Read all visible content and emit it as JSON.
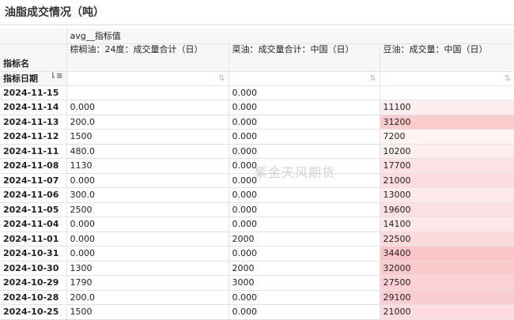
{
  "title": "油脂成交情况（吨）",
  "table": {
    "measure_label": "avg__指标值",
    "dim_label": "指标名",
    "row_dim_label": "指标日期",
    "columns": [
      "棕榈油：24度：成交量合计（日）",
      "菜油：成交量合计：中国（日）",
      "豆油：成交量：中国（日）"
    ],
    "rows": [
      {
        "date": "2024-11-15",
        "c1": "",
        "c2": "0.000",
        "c3": ""
      },
      {
        "date": "2024-11-14",
        "c1": "0.000",
        "c2": "0.000",
        "c3": "11100"
      },
      {
        "date": "2024-11-13",
        "c1": "200.0",
        "c2": "0.000",
        "c3": "31200"
      },
      {
        "date": "2024-11-12",
        "c1": "1500",
        "c2": "0.000",
        "c3": "7200"
      },
      {
        "date": "2024-11-11",
        "c1": "480.0",
        "c2": "0.000",
        "c3": "10200"
      },
      {
        "date": "2024-11-08",
        "c1": "1130",
        "c2": "0.000",
        "c3": "17700"
      },
      {
        "date": "2024-11-07",
        "c1": "0.000",
        "c2": "0.000",
        "c3": "21000"
      },
      {
        "date": "2024-11-06",
        "c1": "300.0",
        "c2": "0.000",
        "c3": "13000"
      },
      {
        "date": "2024-11-05",
        "c1": "2500",
        "c2": "0.000",
        "c3": "19600"
      },
      {
        "date": "2024-11-04",
        "c1": "0.000",
        "c2": "0.000",
        "c3": "14100"
      },
      {
        "date": "2024-11-01",
        "c1": "0.000",
        "c2": "2000",
        "c3": "22500"
      },
      {
        "date": "2024-10-31",
        "c1": "0.000",
        "c2": "0.000",
        "c3": "34400"
      },
      {
        "date": "2024-10-30",
        "c1": "1300",
        "c2": "2000",
        "c3": "32000"
      },
      {
        "date": "2024-10-29",
        "c1": "1790",
        "c2": "3000",
        "c3": "27500"
      },
      {
        "date": "2024-10-28",
        "c1": "200.0",
        "c2": "0.000",
        "c3": "29100"
      },
      {
        "date": "2024-10-25",
        "c1": "1500",
        "c2": "0.000",
        "c3": "21000"
      }
    ]
  },
  "watermark": "紫金天风期货",
  "colors": {
    "heat_low": "#fff4f4",
    "heat_high": "#f9c5c8",
    "header_bg": "#f7f7f7",
    "border": "#e3e3e3"
  },
  "icons": {
    "sort_active": "sort-desc-icon",
    "sort_inactive": "sort-icon"
  }
}
